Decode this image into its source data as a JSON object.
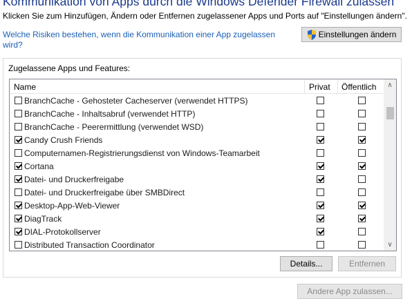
{
  "window": {
    "title": "Kommunikation von Apps durch die Windows Defender Firewall zulassen",
    "description": "Klicken Sie zum Hinzufügen, Ändern oder Entfernen zugelassener Apps und Ports auf \"Einstellungen ändern\".",
    "risk_link": "Welche Risiken bestehen, wenn die Kommunikation einer App zugelassen wird?",
    "settings_button": "Einstellungen ändern"
  },
  "allowed_apps": {
    "group_label": "Zugelassene Apps und Features:",
    "columns": {
      "name": "Name",
      "private": "Privat",
      "public": "Öffentlich"
    },
    "rows": [
      {
        "name": "BranchCache - Gehosteter Cacheserver (verwendet HTTPS)",
        "enabled": false,
        "private": false,
        "public": false
      },
      {
        "name": "BranchCache - Inhaltsabruf (verwendet HTTP)",
        "enabled": false,
        "private": false,
        "public": false
      },
      {
        "name": "BranchCache - Peerermittlung (verwendet WSD)",
        "enabled": false,
        "private": false,
        "public": false
      },
      {
        "name": "Candy Crush Friends",
        "enabled": true,
        "private": true,
        "public": true
      },
      {
        "name": "Computernamen-Registrierungsdienst von Windows-Teamarbeit",
        "enabled": false,
        "private": false,
        "public": false
      },
      {
        "name": "Cortana",
        "enabled": true,
        "private": true,
        "public": true
      },
      {
        "name": "Datei- und Druckerfreigabe",
        "enabled": true,
        "private": true,
        "public": false
      },
      {
        "name": "Datei- und Druckerfreigabe über SMBDirect",
        "enabled": false,
        "private": false,
        "public": false
      },
      {
        "name": "Desktop-App-Web-Viewer",
        "enabled": true,
        "private": true,
        "public": true
      },
      {
        "name": "DiagTrack",
        "enabled": true,
        "private": true,
        "public": true
      },
      {
        "name": "DIAL-Protokollserver",
        "enabled": true,
        "private": true,
        "public": false
      },
      {
        "name": "Distributed Transaction Coordinator",
        "enabled": false,
        "private": false,
        "public": false
      }
    ],
    "details_button": "Details...",
    "remove_button": "Entfernen"
  },
  "allow_other_button": "Andere App zulassen..."
}
